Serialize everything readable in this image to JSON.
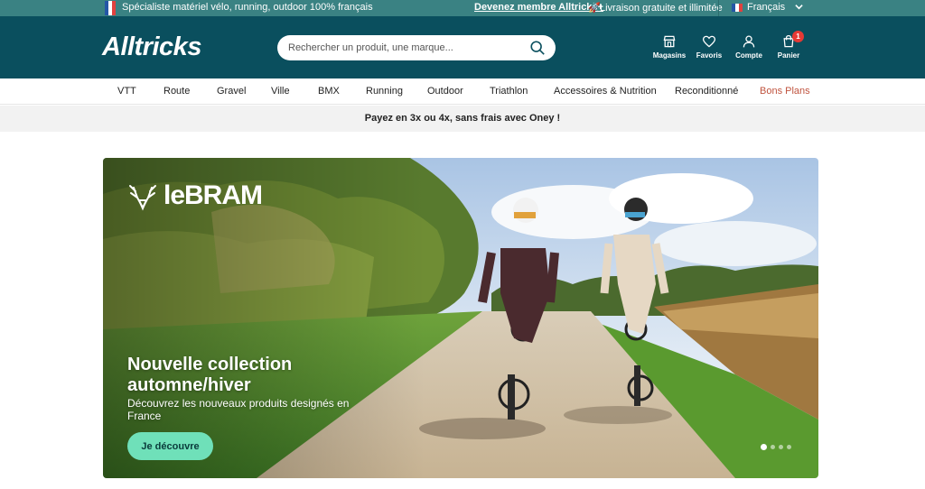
{
  "topbar": {
    "tagline": "Spécialiste matériel vélo, running, outdoor 100% français",
    "member_link": "Devenez membre Alltricks+",
    "shipping": "Livraison gratuite et illimitée",
    "language": "Français"
  },
  "header": {
    "logo": "Alltricks",
    "search_placeholder": "Rechercher un produit, une marque...",
    "icons": [
      {
        "label": "Magasins",
        "icon": "store-icon"
      },
      {
        "label": "Favoris",
        "icon": "heart-icon"
      },
      {
        "label": "Compte",
        "icon": "user-icon"
      },
      {
        "label": "Panier",
        "icon": "cart-icon",
        "badge": "1"
      }
    ]
  },
  "nav": {
    "items": [
      "VTT",
      "Route",
      "Gravel",
      "Ville",
      "BMX",
      "Running",
      "Outdoor",
      "Triathlon",
      "Accessoires & Nutrition",
      "Reconditionné",
      "Bons Plans"
    ]
  },
  "promo_bar": "Payez en 3x ou 4x, sans frais avec Oney !",
  "hero": {
    "brand": "leBRAM",
    "title": "Nouvelle collection automne/hiver",
    "description": "Découvrez les nouveaux produits designés en France",
    "cta": "Je découvre",
    "slides_total": 4,
    "active_slide": 1
  },
  "colors": {
    "topbar": "#3a8283",
    "header": "#0a4f5e",
    "cta": "#6fe0b9",
    "promo_link": "#c0543f"
  }
}
